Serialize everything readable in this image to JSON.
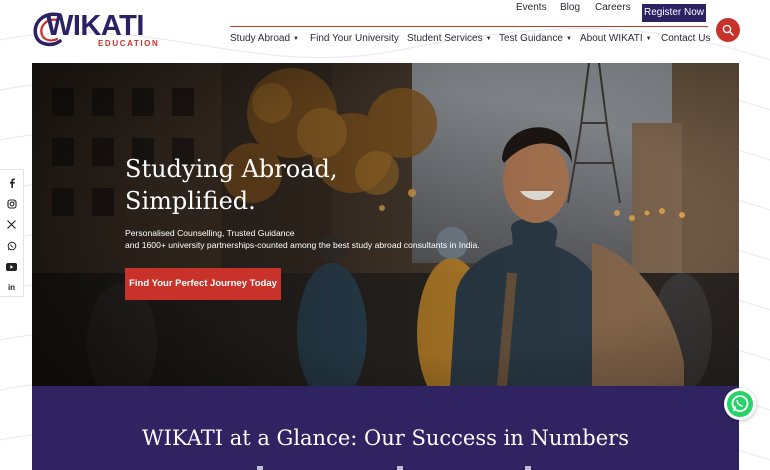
{
  "brand": {
    "name": "WIKATI",
    "tagline": "EDUCATION",
    "primary_color": "#2b2163",
    "accent_color": "#c8322a"
  },
  "top_links": [
    "Events",
    "Blog",
    "Careers"
  ],
  "register_label": "Register Now",
  "nav": [
    {
      "label": "Study Abroad",
      "dropdown": true
    },
    {
      "label": "Find Your University",
      "dropdown": false
    },
    {
      "label": "Student Services",
      "dropdown": true
    },
    {
      "label": "Test Guidance",
      "dropdown": true
    },
    {
      "label": "About WIKATI",
      "dropdown": true
    },
    {
      "label": "Contact Us",
      "dropdown": false
    }
  ],
  "search_icon": "search-icon",
  "social": [
    "facebook-icon",
    "instagram-icon",
    "x-icon",
    "whatsapp-icon",
    "youtube-icon",
    "linkedin-icon"
  ],
  "hero": {
    "title_line1": "Studying Abroad,",
    "title_line2": "Simplified.",
    "sub_line1": "Personalised Counselling, Trusted Guidance",
    "sub_line2": "and 1600+ university partnerships-counted among the best study abroad consultants in India.",
    "cta": "Find Your Perfect Journey Today"
  },
  "stats": {
    "title": "WIKATI at a Glance: Our Success in Numbers"
  }
}
